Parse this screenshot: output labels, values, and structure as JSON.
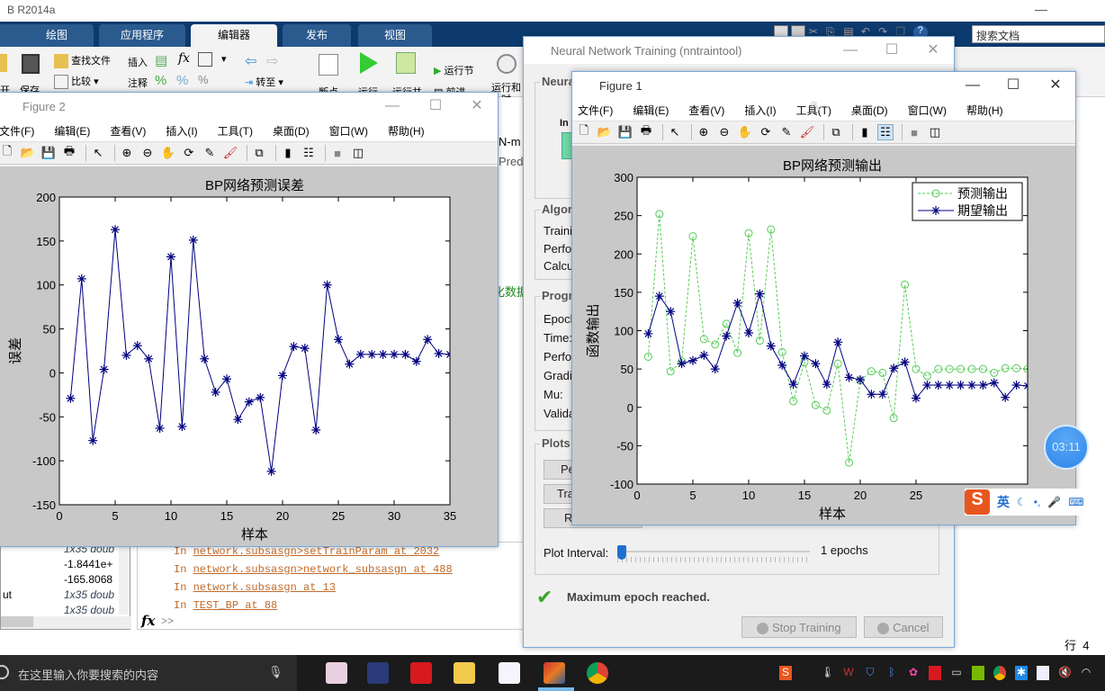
{
  "matlab": {
    "title": "B R2014a",
    "tabs": [
      "绘图",
      "应用程序",
      "编辑器",
      "发布",
      "视图"
    ],
    "active_tab": "编辑器",
    "search_placeholder": "搜索文档",
    "ribbon": {
      "open": "开",
      "save": "保存",
      "find_files": "查找文件",
      "compare": "比较",
      "insert": "插入",
      "comment": "注释",
      "goto": "转至",
      "breakpoints": "断点",
      "run": "运行",
      "run_advance": "运行并",
      "run_section": "运行节",
      "advance": "前进",
      "run_time": "运行和\n计时"
    },
    "workspace": {
      "rows": [
        {
          "name": "",
          "value": "1x35 doub"
        },
        {
          "name": "",
          "value": "-1.8441e+"
        },
        {
          "name": "",
          "value": "-165.8068"
        },
        {
          "name": "ut",
          "value": "1x35 doub"
        },
        {
          "name": "",
          "value": "1x35 doub"
        }
      ]
    },
    "console": {
      "lines": [
        {
          "prefix": "In ",
          "link": "network.subsasgn>setTrainParam at 2032"
        },
        {
          "prefix": "In ",
          "link": "network.subsasgn>network_subsasgn at 488"
        },
        {
          "prefix": "In ",
          "link": "network.subsasgn at 13"
        },
        {
          "prefix": "In ",
          "link": "TEST_BP at 88"
        }
      ],
      "prompt": ">>",
      "fx": "fx"
    },
    "status_row_label": "行",
    "status_row_value": "4",
    "editor_fragments": {
      "nm": "N-m",
      "pred": "Pred",
      "green_text": "化数据"
    }
  },
  "figure2": {
    "title": "Figure 2",
    "menu": [
      "文件(F)",
      "编辑(E)",
      "查看(V)",
      "插入(I)",
      "工具(T)",
      "桌面(D)",
      "窗口(W)",
      "帮助(H)"
    ]
  },
  "figure1": {
    "title": "Figure 1",
    "menu": [
      "文件(F)",
      "编辑(E)",
      "查看(V)",
      "插入(I)",
      "工具(T)",
      "桌面(D)",
      "窗口(W)",
      "帮助(H)"
    ]
  },
  "nntraintool": {
    "title": "Neural Network Training (nntraintool)",
    "groups": {
      "network": "Neura",
      "algorithms": "Algor",
      "progress": "Progr",
      "plots": "Plots"
    },
    "network_input_label": "In",
    "algo_rows": [
      "Traini",
      "Perfo",
      "Calcu"
    ],
    "progress_rows": [
      "Epoch",
      "Time:",
      "Perfo",
      "Gradi",
      "Mu:",
      "Valida"
    ],
    "plot_buttons": [
      "Pe",
      "Tra",
      "R"
    ],
    "plot_interval_label": "Plot Interval:",
    "plot_interval_value": "1 epochs",
    "plot_interval_fraction": 0.0,
    "status": "Maximum epoch reached.",
    "stop_button": "Stop Training",
    "cancel_button": "Cancel"
  },
  "chart_data": [
    {
      "type": "line",
      "title": "BP网络预测误差",
      "xlabel": "样本",
      "ylabel": "误差",
      "xlim": [
        0,
        35
      ],
      "ylim": [
        -150,
        200
      ],
      "xticks": [
        0,
        5,
        10,
        15,
        20,
        25,
        30,
        35
      ],
      "yticks": [
        -150,
        -100,
        -50,
        0,
        50,
        100,
        150,
        200
      ],
      "grid": false,
      "series": [
        {
          "name": "误差",
          "color": "#000080",
          "marker": "*",
          "style": "solid",
          "x": [
            1,
            2,
            3,
            4,
            5,
            6,
            7,
            8,
            9,
            10,
            11,
            12,
            13,
            14,
            15,
            16,
            17,
            18,
            19,
            20,
            21,
            22,
            23,
            24,
            25,
            26,
            27,
            28,
            29,
            30,
            31,
            32,
            33,
            34,
            35
          ],
          "values": [
            -29,
            107,
            -77,
            4,
            163,
            20,
            31,
            16,
            -63,
            132,
            -61,
            151,
            16,
            -22,
            -7,
            -53,
            -33,
            -28,
            -112,
            -3,
            30,
            28,
            -65,
            100,
            38,
            10,
            21,
            21,
            21,
            21,
            21,
            13,
            38,
            22,
            21
          ]
        }
      ]
    },
    {
      "type": "line",
      "title": "BP网络预测输出",
      "xlabel": "样本",
      "ylabel": "函数输出",
      "xlim": [
        0,
        35
      ],
      "ylim": [
        -100,
        300
      ],
      "xticks": [
        0,
        5,
        10,
        15,
        20,
        25
      ],
      "yticks": [
        -100,
        -50,
        0,
        50,
        100,
        150,
        200,
        250,
        300
      ],
      "grid": false,
      "legend_position": "top-right",
      "series": [
        {
          "name": "预测输出",
          "color": "#55cc55",
          "marker": "o",
          "style": "dashed",
          "x": [
            1,
            2,
            3,
            4,
            5,
            6,
            7,
            8,
            9,
            10,
            11,
            12,
            13,
            14,
            15,
            16,
            17,
            18,
            19,
            20,
            21,
            22,
            23,
            24,
            25,
            26,
            27,
            28,
            29,
            30,
            31,
            32,
            33,
            34,
            35
          ],
          "values": [
            66,
            252,
            47,
            60,
            223,
            89,
            82,
            109,
            71,
            227,
            87,
            232,
            72,
            8,
            59,
            3,
            -4,
            57,
            -72,
            35,
            47,
            45,
            -14,
            160,
            50,
            41,
            50,
            50,
            50,
            50,
            50,
            45,
            51,
            51,
            50
          ]
        },
        {
          "name": "期望输出",
          "color": "#000080",
          "marker": "*",
          "style": "solid",
          "x": [
            1,
            2,
            3,
            4,
            5,
            6,
            7,
            8,
            9,
            10,
            11,
            12,
            13,
            14,
            15,
            16,
            17,
            18,
            19,
            20,
            21,
            22,
            23,
            24,
            25,
            26,
            27,
            28,
            29,
            30,
            31,
            32,
            33,
            34,
            35
          ],
          "values": [
            96,
            145,
            125,
            57,
            61,
            68,
            50,
            93,
            136,
            97,
            148,
            80,
            55,
            30,
            67,
            57,
            30,
            85,
            39,
            36,
            17,
            17,
            51,
            59,
            12,
            29,
            29,
            29,
            29,
            29,
            29,
            32,
            13,
            29,
            28
          ]
        }
      ]
    }
  ],
  "overlays": {
    "timer": "03:11",
    "ime": {
      "lang": "英"
    }
  },
  "taskbar": {
    "search_placeholder": "在这里输入你要搜索的内容"
  }
}
